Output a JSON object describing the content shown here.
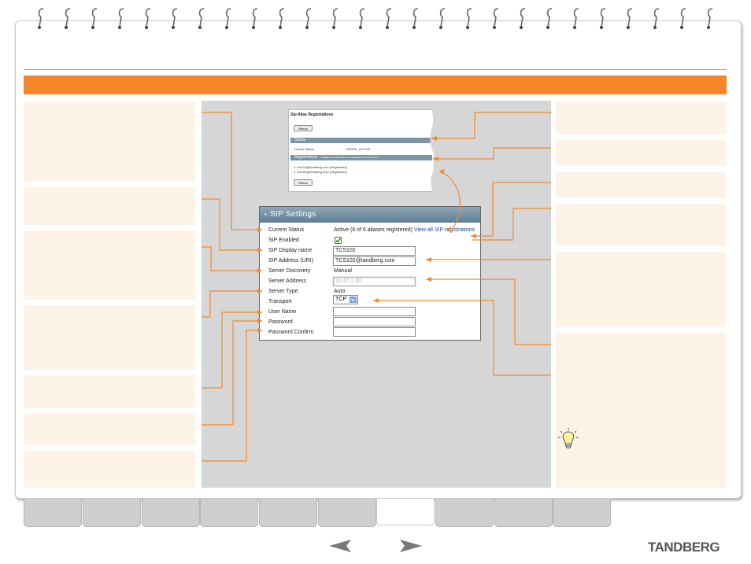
{
  "alias_window": {
    "title": "Sip Alias Registrations",
    "return_button": "Return",
    "status_heading": "Status",
    "current_status_label": "Current Status",
    "current_status_value": "SIPSRV_ACTIVE",
    "registrations_heading": "Registrations",
    "registrations_note": "Displays all aliases that are registered to the Sip server",
    "registration_items": [
      "1. tcs101@tandberg.com (Registered)",
      "2. tcs102@tandberg.com (Registered)"
    ],
    "return_button_bottom": "Return"
  },
  "sip_settings": {
    "title": "SIP Settings",
    "labels": {
      "current_status": "Current Status",
      "sip_enabled": "SIP Enabled",
      "display_name": "SIP Display name",
      "address": "SIP Address (URI)",
      "server_discovery": "Server Discovery",
      "server_address": "Server Address",
      "server_type": "Server Type",
      "transport": "Transport",
      "user_name": "User Name",
      "password": "Password",
      "password_confirm": "Password Confirm"
    },
    "values": {
      "current_status": "Active (6 of 6 aliases registered)",
      "view_link": "View all SIP registrations",
      "display_name": "TCS102",
      "address": "TCS102@tandberg.com",
      "server_discovery": "Manual",
      "server_address": "10.47.1.30",
      "server_type": "Auto",
      "transport": "TCP",
      "user_name": "",
      "password": "",
      "password_confirm": ""
    }
  },
  "navigation": {
    "prev_label": "◀",
    "next_label": "▶"
  },
  "logo": "TANDBERG",
  "colors": {
    "accent": "#f5862a",
    "box_fill": "#fdf3e6",
    "panel_header": "#5d7d93"
  }
}
